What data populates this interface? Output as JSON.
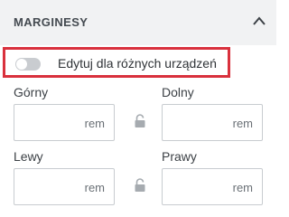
{
  "section": {
    "title": "MARGINESY"
  },
  "toggle": {
    "label": "Edytuj dla różnych urządzeń",
    "on": false
  },
  "fields": {
    "top": {
      "label": "Górny",
      "value": "",
      "unit": "rem"
    },
    "bottom": {
      "label": "Dolny",
      "value": "",
      "unit": "rem"
    },
    "left": {
      "label": "Lewy",
      "value": "",
      "unit": "rem"
    },
    "right": {
      "label": "Prawy",
      "value": "",
      "unit": "rem"
    }
  },
  "colors": {
    "highlight": "#d9313d",
    "header_bg": "#f1f2f3",
    "toggle_off": "#c9ccd0"
  },
  "icons": {
    "collapse": "chevron-up-icon",
    "link": "lock-icon"
  }
}
